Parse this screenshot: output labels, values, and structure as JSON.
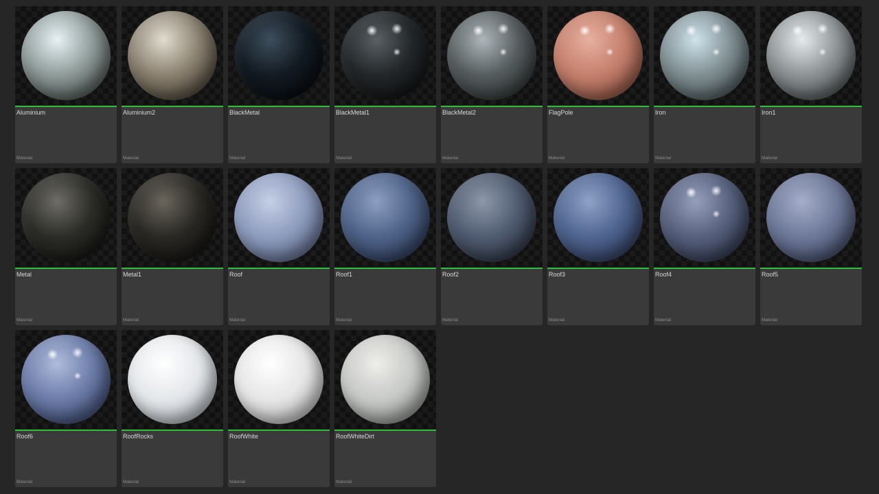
{
  "assets": [
    {
      "name": "Aluminium",
      "type": "Material",
      "sphere_icon": "material-sphere-icon",
      "colors": {
        "base": "#8e9a98",
        "light": "#e8f2f6",
        "dark": "#3a423f"
      },
      "specular": false
    },
    {
      "name": "Aluminium2",
      "type": "Material",
      "sphere_icon": "material-sphere-icon",
      "colors": {
        "base": "#8a8070",
        "light": "#e0dccf",
        "dark": "#3a3328"
      },
      "specular": false
    },
    {
      "name": "BlackMetal",
      "type": "Material",
      "sphere_icon": "material-sphere-icon",
      "colors": {
        "base": "#121a22",
        "light": "#3d4e5c",
        "dark": "#05080b"
      },
      "specular": false
    },
    {
      "name": "BlackMetal1",
      "type": "Material",
      "sphere_icon": "material-sphere-icon",
      "colors": {
        "base": "#222629",
        "light": "#5a6064",
        "dark": "#0b0c0d"
      },
      "specular": true
    },
    {
      "name": "BlackMetal2",
      "type": "Material",
      "sphere_icon": "material-sphere-icon",
      "colors": {
        "base": "#555c5e",
        "light": "#aeb6ba",
        "dark": "#25292a"
      },
      "specular": true
    },
    {
      "name": "FlagPole",
      "type": "Material",
      "sphere_icon": "material-sphere-icon",
      "colors": {
        "base": "#c47f6c",
        "light": "#e8b0a0",
        "dark": "#7a4638"
      },
      "specular": true
    },
    {
      "name": "Iron",
      "type": "Material",
      "sphere_icon": "material-sphere-icon",
      "colors": {
        "base": "#7f8e92",
        "light": "#cfe3ec",
        "dark": "#3b4548"
      },
      "specular": true
    },
    {
      "name": "Iron1",
      "type": "Material",
      "sphere_icon": "material-sphere-icon",
      "colors": {
        "base": "#8c9294",
        "light": "#e6eaec",
        "dark": "#3c4042"
      },
      "specular": true
    },
    {
      "name": "Metal",
      "type": "Material",
      "sphere_icon": "material-sphere-icon",
      "colors": {
        "base": "#2b2b27",
        "light": "#6e6d66",
        "dark": "#0e0e0c"
      },
      "specular": false
    },
    {
      "name": "Metal1",
      "type": "Material",
      "sphere_icon": "material-sphere-icon",
      "colors": {
        "base": "#2a2824",
        "light": "#6a665d",
        "dark": "#0e0d0b"
      },
      "specular": false
    },
    {
      "name": "Roof",
      "type": "Material",
      "sphere_icon": "material-sphere-icon",
      "colors": {
        "base": "#8d9bbd",
        "light": "#c6d0e6",
        "dark": "#4f5a78"
      },
      "specular": false
    },
    {
      "name": "Roof1",
      "type": "Material",
      "sphere_icon": "material-sphere-icon",
      "colors": {
        "base": "#4e6288",
        "light": "#8da0c2",
        "dark": "#24304a"
      },
      "specular": false
    },
    {
      "name": "Roof2",
      "type": "Material",
      "sphere_icon": "material-sphere-icon",
      "colors": {
        "base": "#4f5b70",
        "light": "#8d98aa",
        "dark": "#232a36"
      },
      "specular": false
    },
    {
      "name": "Roof3",
      "type": "Material",
      "sphere_icon": "material-sphere-icon",
      "colors": {
        "base": "#4f6490",
        "light": "#8fa2c6",
        "dark": "#26324e"
      },
      "specular": false
    },
    {
      "name": "Roof4",
      "type": "Material",
      "sphere_icon": "material-sphere-icon",
      "colors": {
        "base": "#56607c",
        "light": "#96a0bc",
        "dark": "#262c40"
      },
      "specular": true
    },
    {
      "name": "Roof5",
      "type": "Material",
      "sphere_icon": "material-sphere-icon",
      "colors": {
        "base": "#6d7898",
        "light": "#a5afca",
        "dark": "#353d56"
      },
      "specular": false
    },
    {
      "name": "Roof6",
      "type": "Material",
      "sphere_icon": "material-sphere-icon",
      "colors": {
        "base": "#6b7ca8",
        "light": "#b0bcdc",
        "dark": "#323d60"
      },
      "specular": true
    },
    {
      "name": "RoofRocks",
      "type": "Material",
      "sphere_icon": "material-sphere-icon",
      "colors": {
        "base": "#e4e7ea",
        "light": "#ffffff",
        "dark": "#9aa0a6"
      },
      "specular": false
    },
    {
      "name": "RoofWhite",
      "type": "Material",
      "sphere_icon": "material-sphere-icon",
      "colors": {
        "base": "#e6e6e6",
        "light": "#ffffff",
        "dark": "#a8a8a8"
      },
      "specular": false
    },
    {
      "name": "RoofWhiteDirt",
      "type": "Material",
      "sphere_icon": "material-sphere-icon",
      "colors": {
        "base": "#c7c9c6",
        "light": "#eeeeea",
        "dark": "#7c7f7b"
      },
      "specular": false
    }
  ],
  "colors": {
    "background": "#262626",
    "tile": "#3a3a3a",
    "material_underline": "#2fbf3a",
    "name_text": "#d8d8d8",
    "type_text": "#8c8c8c"
  }
}
